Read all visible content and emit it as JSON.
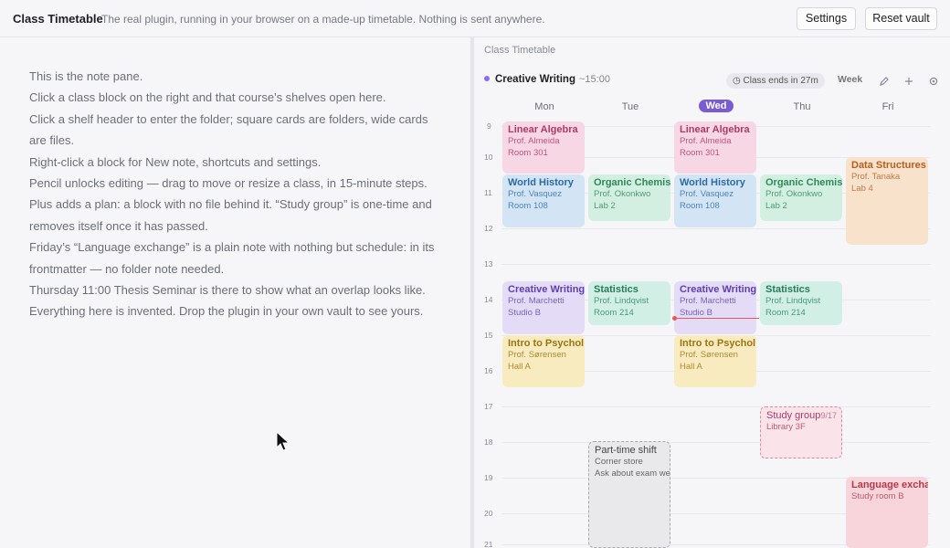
{
  "app": {
    "title": "Class Timetable",
    "subtitle": "The real plugin, running in your browser on a made-up timetable. Nothing is sent anywhere.",
    "settings_label": "Settings",
    "reset_label": "Reset vault"
  },
  "note": {
    "lines": [
      "This is the note pane.",
      "Click a class block on the right and that course's shelves open here.",
      "Click a shelf header to enter the folder; square cards are folders, wide cards",
      "are files.",
      "Right-click a block for New note, shortcuts and settings.",
      "Pencil unlocks editing — drag to move or resize a class, in 15-minute steps.",
      "Plus adds a plan: a block with no file behind it. “Study group” is one-time and",
      "removes itself once it has passed.",
      "Friday’s “Language exchange” is a plain note with nothing but schedule: in its",
      "frontmatter — no folder note needed.",
      "Thursday 11:00 Thesis Seminar is there to show what an overlap looks like.",
      "Everything here is invented. Drop the plugin in your own vault to see yours."
    ]
  },
  "calendar": {
    "pane_title": "Class Timetable",
    "current_class": "Creative Writing",
    "current_time": "~15:00",
    "ends_badge": "Class ends in 27m",
    "view_mode": "Week",
    "days": [
      "Mon",
      "Tue",
      "Wed",
      "Thu",
      "Fri"
    ],
    "today": "Wed",
    "hours": [
      "9",
      "10",
      "11",
      "12",
      "13",
      "14",
      "15",
      "16",
      "17",
      "18",
      "19",
      "20",
      "21"
    ],
    "blocks": [
      {
        "title": "Linear Algebra",
        "instructor": "Prof. Almeida",
        "room": "Room 301",
        "color": "pink"
      },
      {
        "title": "Linear Algebra",
        "instructor": "Prof. Almeida",
        "room": "Room 301",
        "color": "pink"
      },
      {
        "title": "World History",
        "instructor": "Prof. Vasquez",
        "room": "Room 108",
        "color": "blue"
      },
      {
        "title": "Organic Chemis",
        "instructor": "Prof. Okonkwo",
        "room": "Lab 2",
        "color": "green"
      },
      {
        "title": "World History",
        "instructor": "Prof. Vasquez",
        "room": "Room 108",
        "color": "blue"
      },
      {
        "title": "Organic Chemis",
        "instructor": "Prof. Okonkwo",
        "room": "Lab 2",
        "color": "green"
      },
      {
        "title": "Data Structures",
        "instructor": "Prof. Tanaka",
        "room": "Lab 4",
        "color": "peach"
      },
      {
        "title": "Creative Writing",
        "instructor": "Prof. Marchetti",
        "room": "Studio B",
        "color": "purple"
      },
      {
        "title": "Statistics",
        "instructor": "Prof. Lindqvist",
        "room": "Room 214",
        "color": "teal"
      },
      {
        "title": "Creative Writing",
        "instructor": "Prof. Marchetti",
        "room": "Studio B",
        "color": "purple"
      },
      {
        "title": "Statistics",
        "instructor": "Prof. Lindqvist",
        "room": "Room 214",
        "color": "teal"
      },
      {
        "title": "Intro to Psychol",
        "instructor": "Prof. Sørensen",
        "room": "Hall A",
        "color": "yellow"
      },
      {
        "title": "Intro to Psychol",
        "instructor": "Prof. Sørensen",
        "room": "Hall A",
        "color": "yellow"
      },
      {
        "title": "Study group",
        "instructor": "Library 3F",
        "count": "9/17",
        "color": "study"
      },
      {
        "title": "Part-time shift",
        "instructor": "Corner store",
        "room": "Ask about exam week",
        "color": "gray"
      },
      {
        "title": "Language exchange",
        "instructor": "Study room B",
        "color": "rose"
      }
    ]
  },
  "colors": {
    "accent": "#7a5bd6",
    "now_line": "#e05a5a"
  }
}
